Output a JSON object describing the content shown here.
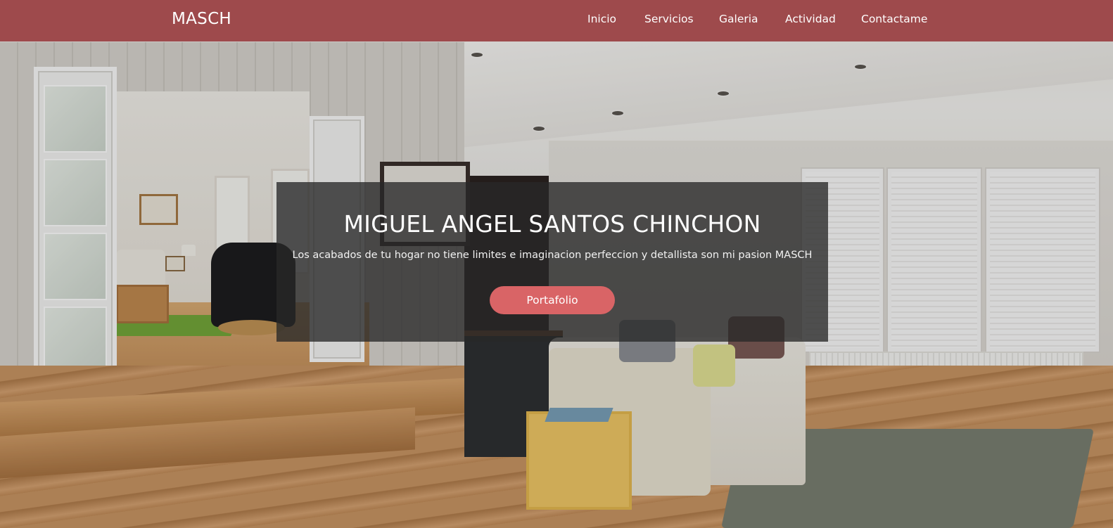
{
  "navbar": {
    "brand": "MASCH",
    "background_color": "#9e4a4c",
    "links": [
      {
        "label": "Inicio"
      },
      {
        "label": "Servicios"
      },
      {
        "label": "Galeria"
      },
      {
        "label": "Actividad"
      },
      {
        "label": "Contactame"
      }
    ]
  },
  "hero": {
    "title": "MIGUEL ANGEL SANTOS CHINCHON",
    "subtitle": "Los acabados de tu hogar no tiene limites e imaginacion perfeccion y detallista son mi pasion MASCH",
    "button_label": "Portafolio",
    "button_color": "#d96466",
    "overlay_color": "rgba(40,40,40,0.78)"
  },
  "background": {
    "image": "living-room-interior-photo"
  }
}
